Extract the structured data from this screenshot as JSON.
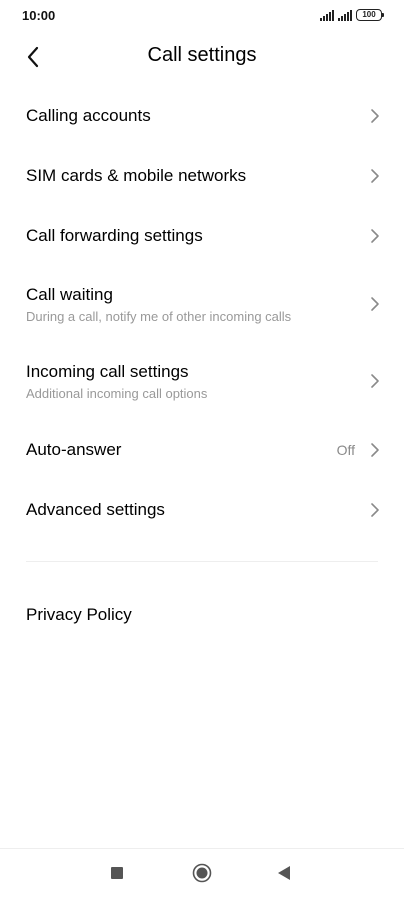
{
  "status_bar": {
    "time": "10:00",
    "battery_level": "100",
    "icons": [
      "signal-icon",
      "signal-icon",
      "battery-icon"
    ]
  },
  "header": {
    "title": "Call settings",
    "back_icon": "chevron-left-icon"
  },
  "settings": [
    {
      "title": "Calling accounts",
      "subtitle": "",
      "value": ""
    },
    {
      "title": "SIM cards & mobile networks",
      "subtitle": "",
      "value": ""
    },
    {
      "title": "Call forwarding settings",
      "subtitle": "",
      "value": ""
    },
    {
      "title": "Call waiting",
      "subtitle": "During a call, notify me of other incoming calls",
      "value": ""
    },
    {
      "title": "Incoming call settings",
      "subtitle": "Additional incoming call options",
      "value": ""
    },
    {
      "title": "Auto-answer",
      "subtitle": "",
      "value": "Off"
    },
    {
      "title": "Advanced settings",
      "subtitle": "",
      "value": ""
    }
  ],
  "privacy_policy": "Privacy Policy",
  "nav_bar": {
    "icons": [
      "recents-square-icon",
      "home-circle-icon",
      "back-triangle-icon"
    ]
  },
  "colors": {
    "background": "#ffffff",
    "text_primary": "#000000",
    "text_secondary": "#999999",
    "chevron": "#8a8a8a",
    "divider": "#eeeeee"
  }
}
